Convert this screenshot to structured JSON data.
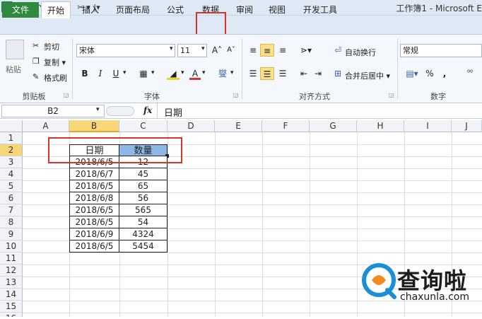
{
  "window": {
    "title": "工作簿1 - Microsoft E"
  },
  "quick_access": {
    "undo": "↶",
    "redo": "↷",
    "dropdown": "▾"
  },
  "tabs": [
    "文件",
    "开始",
    "插入",
    "页面布局",
    "公式",
    "数据",
    "审阅",
    "视图",
    "开发工具"
  ],
  "ribbon": {
    "clipboard": {
      "paste": "粘贴",
      "cut": "剪切",
      "copy": "复制 ▾",
      "format_painter": "格式刷",
      "group": "剪贴板"
    },
    "font": {
      "name": "宋体",
      "size": "11",
      "grow": "A˄",
      "shrink": "A˅",
      "bold": "B",
      "italic": "I",
      "underline": "U",
      "border": "▦",
      "fill": "◢",
      "color": "A",
      "phonetic": "燮",
      "group": "字体"
    },
    "alignment": {
      "wrap": "自动换行",
      "merge": "合并后居中 ▾",
      "group": "对齐方式"
    },
    "number": {
      "format": "常规",
      "percent": "%",
      "comma": ",",
      "decimals": "⁰⁰",
      "group": "数字"
    }
  },
  "formula_bar": {
    "name_box": "B2",
    "fx": "fx",
    "value": "日期"
  },
  "grid": {
    "columns": [
      "A",
      "B",
      "C",
      "D",
      "E",
      "F",
      "G",
      "H",
      "I",
      "J"
    ],
    "rows": [
      "1",
      "2",
      "3",
      "4",
      "5",
      "6",
      "7",
      "8",
      "9",
      "10",
      "11",
      "12",
      "13",
      "14",
      "15",
      "16"
    ],
    "active_cell": "B2"
  },
  "table": {
    "headers": [
      "日期",
      "数量"
    ],
    "rows": [
      [
        "2018/6/5",
        "12"
      ],
      [
        "2018/6/7",
        "45"
      ],
      [
        "2018/6/5",
        "65"
      ],
      [
        "2018/6/8",
        "56"
      ],
      [
        "2018/6/5",
        "565"
      ],
      [
        "2018/6/5",
        "54"
      ],
      [
        "2018/6/9",
        "4324"
      ],
      [
        "2018/6/5",
        "5454"
      ]
    ]
  },
  "watermark": {
    "brand": "查询啦",
    "url": "chaxunla.com"
  },
  "colors": {
    "highlight_red": "#d9342b",
    "selected_blue": "#8fb6e6",
    "file_tab_green": "#2f8a3e",
    "active_header": "#f8d77a"
  }
}
